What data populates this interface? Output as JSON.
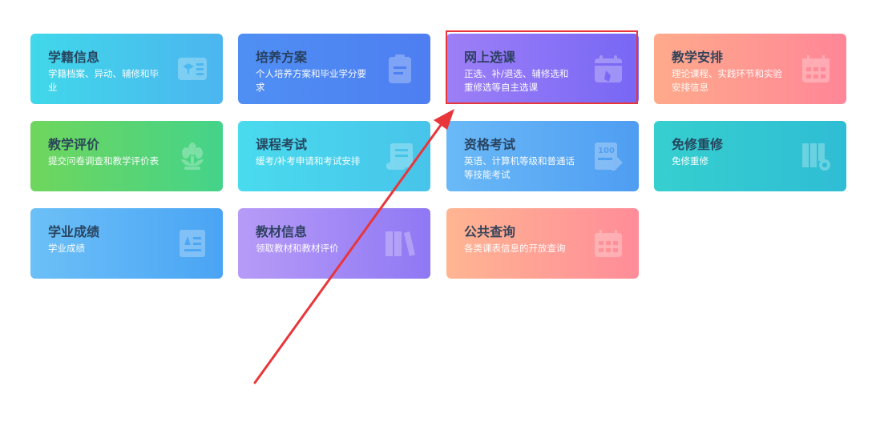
{
  "tiles": [
    {
      "title": "学籍信息",
      "desc": "学籍档案、异动、辅修和毕业",
      "icon": "student-card-icon"
    },
    {
      "title": "培养方案",
      "desc": "个人培养方案和毕业学分要求",
      "icon": "clipboard-icon"
    },
    {
      "title": "网上选课",
      "desc": "正选、补/退选、辅修选和重修选等自主选课",
      "icon": "calendar-select-icon"
    },
    {
      "title": "教学安排",
      "desc": "理论课程、实践环节和实验安排信息",
      "icon": "calendar-grid-icon"
    },
    {
      "title": "教学评价",
      "desc": "提交问卷调查和教学评价表",
      "icon": "flower-icon"
    },
    {
      "title": "课程考试",
      "desc": "缓考/补考申请和考试安排",
      "icon": "scroll-icon"
    },
    {
      "title": "资格考试",
      "desc": "英语、计算机等级和普通话等技能考试",
      "icon": "score-paper-icon"
    },
    {
      "title": "免修重修",
      "desc": "免修重修",
      "icon": "books-gear-icon"
    },
    {
      "title": "学业成绩",
      "desc": "学业成绩",
      "icon": "report-icon"
    },
    {
      "title": "教材信息",
      "desc": "领取教材和教材评价",
      "icon": "books-icon"
    },
    {
      "title": "公共查询",
      "desc": "各类课表信息的开放查询",
      "icon": "calendar-query-icon"
    }
  ],
  "colors": {
    "highlight": "#e8363a",
    "arrow": "#e8363a"
  }
}
